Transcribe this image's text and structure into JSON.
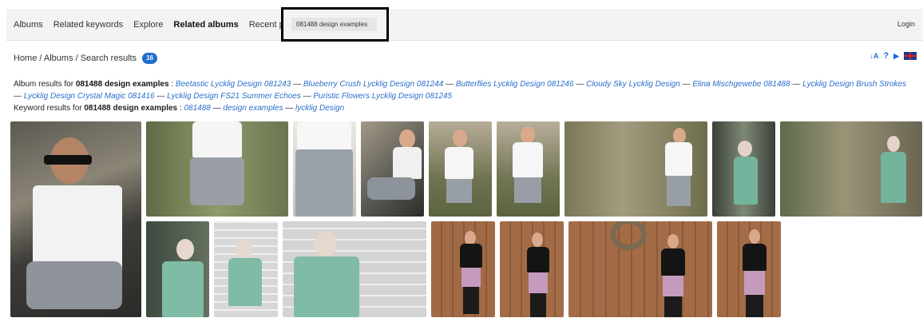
{
  "nav": {
    "items": [
      "Albums",
      "Related keywords",
      "Explore",
      "Related albums",
      "Recent photos"
    ],
    "active_index": 3
  },
  "search": {
    "value": "081488 design examples"
  },
  "login": "Login",
  "breadcrumb": {
    "text": "Home / Albums / Search results",
    "count": "16"
  },
  "tools": {
    "sort": "↓A",
    "help": "?",
    "play": "▶"
  },
  "album_results": {
    "prefix": "Album results for",
    "query": "081488 design examples",
    "colon": " :",
    "links": [
      "Beetastic Lycklig Design 081243",
      "Blueberry Crush Lycklig Design 081244",
      "Butterflies Lycklig Design 081246",
      "Cloudy Sky Lycklig Design",
      "Elina Mischgewebe 081488",
      "Lycklig Design Brush Strokes",
      "Lycklig Design Crystal Magic 081416",
      "Lycklig Design FS21 Summer Echoes",
      "Puristic Flowers Lycklig Design 081245"
    ]
  },
  "keyword_results": {
    "prefix": "Keyword results for",
    "query": "081488 design examples",
    "links": [
      "081488",
      "design examples",
      "lycklig Design"
    ]
  },
  "colors": {
    "link": "#2a6fc9",
    "badge": "#1f6fd1"
  }
}
